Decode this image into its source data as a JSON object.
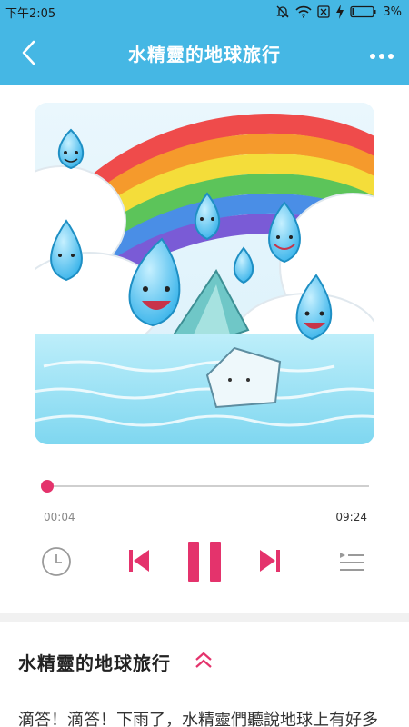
{
  "status_bar": {
    "time": "下午2:05",
    "battery_percent": "3%",
    "icons": [
      "mute-icon",
      "wifi-icon",
      "sim-icon",
      "charging-icon",
      "battery-icon"
    ]
  },
  "header": {
    "title": "水精靈的地球旅行",
    "back_icon": "chevron-left-icon",
    "more_icon": "more-dots-icon"
  },
  "player": {
    "elapsed": "00:04",
    "total": "09:24",
    "progress_fraction": 0.007,
    "state": "playing",
    "controls": [
      "timer-icon",
      "previous-icon",
      "pause-icon",
      "next-icon",
      "playlist-icon"
    ]
  },
  "info": {
    "title": "水精靈的地球旅行",
    "description": "滴答！滴答！下雨了，水精靈們聽說地球上有好多"
  },
  "colors": {
    "header_bg": "#45b7e4",
    "accent": "#e4336c"
  }
}
